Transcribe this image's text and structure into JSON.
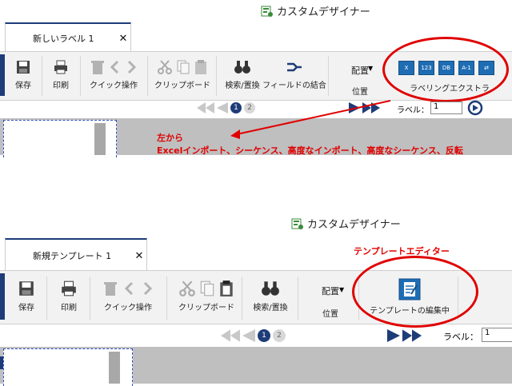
{
  "top": {
    "title": "カスタムデザイナー",
    "tab_label": "新しいラベル 1",
    "tab_close": "✕",
    "buttons": {
      "save": "保存",
      "print": "印刷",
      "quick": "クイック操作",
      "clipboard": "クリップボード",
      "search": "検索/置換",
      "merge": "フィールドの結合",
      "align_top": "配置",
      "align_bottom": "位置",
      "ext": "ラベリングエクストラ"
    },
    "pager": {
      "p1": "1",
      "p2": "2",
      "label_caption": "ラベル：",
      "label_value": "1"
    }
  },
  "annotation_top": {
    "line1": "左から",
    "line2": "Excelインポート、シーケンス、高度なインポート、高度なシーケンス、反転"
  },
  "bottom": {
    "title": "カスタムデザイナー",
    "tab_label": "新規テンプレート 1",
    "tab_close": "✕",
    "buttons": {
      "save": "保存",
      "print": "印刷",
      "quick": "クイック操作",
      "clipboard": "クリップボード",
      "search": "検索/置換",
      "align_top": "配置",
      "align_bottom": "位置",
      "template_edit": "テンプレートの編集中"
    },
    "pager": {
      "p1": "1",
      "p2": "2",
      "label_caption": "ラベル：",
      "label_value": "1"
    }
  },
  "annotation_bottom": {
    "text": "テンプレートエディター"
  },
  "colors": {
    "accent": "#1e3c78",
    "red": "#e00000",
    "ribbon_bg": "#f2f2f2"
  }
}
